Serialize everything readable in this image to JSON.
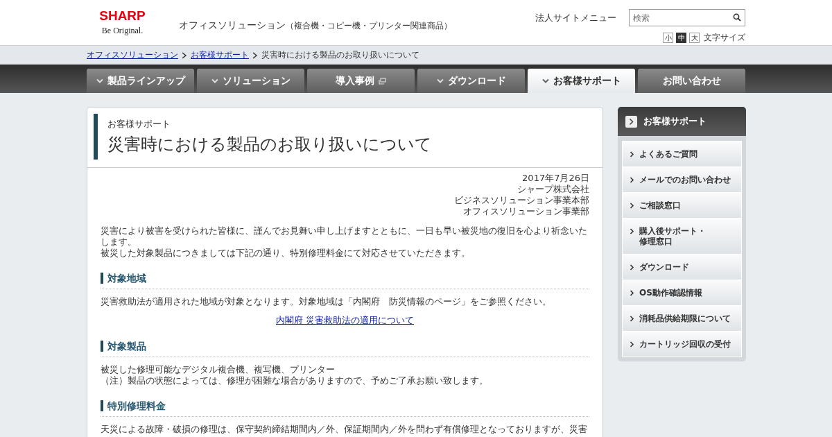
{
  "header": {
    "logo": "SHARP",
    "tagline": "Be Original.",
    "site_title": "オフィスソリューション",
    "site_subtitle": "（複合機・コピー機・プリンター関連商品）",
    "corporate_menu": "法人サイトメニュー",
    "search": {
      "placeholder": "検索"
    },
    "font_sizes": [
      {
        "label": "小",
        "selected": false
      },
      {
        "label": "中",
        "selected": true
      },
      {
        "label": "大",
        "selected": false
      }
    ],
    "font_size_label": "文字サイズ"
  },
  "breadcrumb": {
    "links": [
      "オフィスソリューション",
      "お客様サポート"
    ],
    "current": "災害時における製品のお取り扱いについて"
  },
  "nav_tabs": [
    {
      "label": "製品ラインアップ",
      "kind": "dropdown",
      "selected": false
    },
    {
      "label": "ソリューション",
      "kind": "dropdown",
      "selected": false
    },
    {
      "label": "導入事例",
      "kind": "external",
      "selected": false
    },
    {
      "label": "ダウンロード",
      "kind": "dropdown",
      "selected": false
    },
    {
      "label": "お客様サポート",
      "kind": "dropdown",
      "selected": true
    },
    {
      "label": "お問い合わせ",
      "kind": "plain",
      "selected": false
    }
  ],
  "article": {
    "category": "お客様サポート",
    "title": "災害時における製品のお取り扱いについて",
    "signature": [
      "2017年7月26日",
      "シャープ株式会社",
      "ビジネスソリューション事業本部",
      "オフィスソリューション事業部"
    ],
    "intro": [
      "災害により被害を受けられた皆様に、謹んでお見舞い申し上げますとともに、一日も早い被災地の復旧を心より祈念いたします。",
      "被災した対象製品につきましては下記の通り、特別修理料金にて対応させていただきます。"
    ],
    "sections": [
      {
        "heading": "対象地域",
        "lines": [
          "災害救助法が適用された地域が対象となります。対象地域は「内閣府　防災情報のページ」をご参照ください。"
        ],
        "link": "内閣府 災害救助法の適用について"
      },
      {
        "heading": "対象製品",
        "lines": [
          "被災した修理可能なデジタル複合機、複写機、プリンター",
          "（注）製品の状態によっては、修理が困難な場合がありますので、予めご了承お願い致します。"
        ]
      },
      {
        "heading": "特別修理料金",
        "lines": [
          "天災による故障・破損の修理は、保守契約締結期間内／外、保証期間内／外を問わず有償修理となっておりますが、災害"
        ]
      }
    ]
  },
  "sidebar": {
    "title": "お客様サポート",
    "items": [
      {
        "lines": [
          "よくあるご質問"
        ]
      },
      {
        "lines": [
          "メールでのお問い合わせ"
        ]
      },
      {
        "lines": [
          "ご相談窓口"
        ]
      },
      {
        "lines": [
          "購入後サポート・",
          "修理窓口"
        ]
      },
      {
        "lines": [
          "ダウンロード"
        ]
      },
      {
        "lines": [
          "OS動作確認情報"
        ]
      },
      {
        "lines": [
          "消耗品供給期限について"
        ]
      },
      {
        "lines": [
          "カートリッジ回収の受付"
        ]
      }
    ]
  }
}
